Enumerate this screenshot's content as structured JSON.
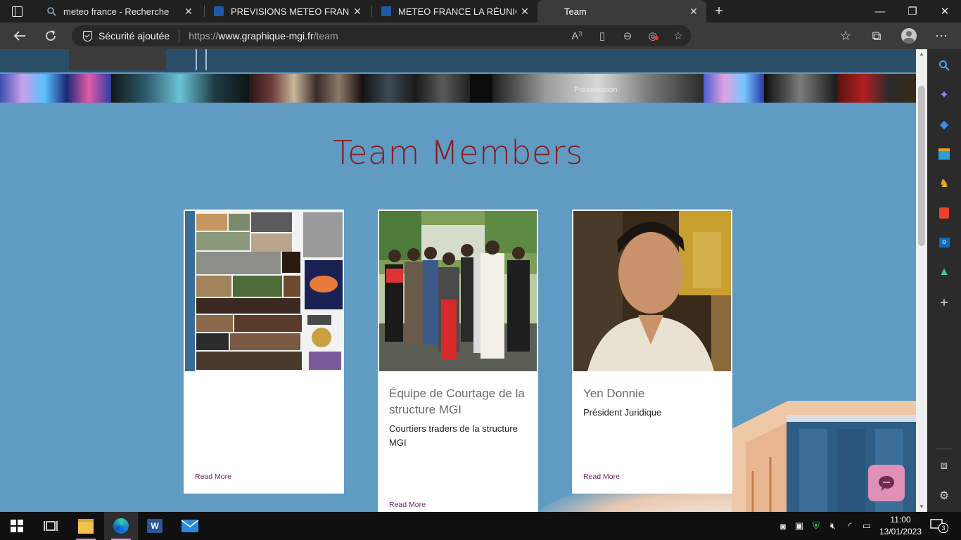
{
  "browser": {
    "tabs": [
      {
        "title": "meteo france - Recherche",
        "close": "✕",
        "active": false
      },
      {
        "title": "PREVISIONS METEO FRANCE - Sit",
        "close": "✕",
        "active": false
      },
      {
        "title": "METEO FRANCE LA RÉUNION par",
        "close": "✕",
        "active": false
      },
      {
        "title": "Team",
        "close": "✕",
        "active": true
      }
    ],
    "new_tab": "+",
    "window_controls": {
      "minimize": "—",
      "restore": "❐",
      "close": "✕"
    },
    "security_label": "Sécurité ajoutée",
    "url": {
      "scheme": "https://",
      "host": "www.graphique-mgi.fr",
      "path": "/team"
    }
  },
  "page": {
    "banner_text": "Présentation",
    "section_title": "Team Members",
    "cards": [
      {
        "name": "",
        "role": "",
        "read_more": "Read More"
      },
      {
        "name": "Équipe de Courtage de la structure MGI",
        "role": "Courtiers traders de la structure MGI",
        "read_more": "Read More"
      },
      {
        "name": "Yen Donnie",
        "role": "Président Juridique",
        "read_more": "Read More"
      }
    ]
  },
  "taskbar": {
    "time": "11:00",
    "date": "13/01/2023",
    "notifications": "3"
  },
  "colors": {
    "page_bg": "#5f9bc2",
    "title": "#8a1c1c",
    "read_more": "#6b2a62",
    "chat_bubble": "#e08fb7"
  },
  "icons": [
    "search-icon",
    "copilot-icon",
    "shopping-icon",
    "tools-icon",
    "games-icon",
    "office-icon",
    "outlook-icon",
    "drop-icon",
    "add-icon",
    "split-screen-icon",
    "settings-icon"
  ]
}
